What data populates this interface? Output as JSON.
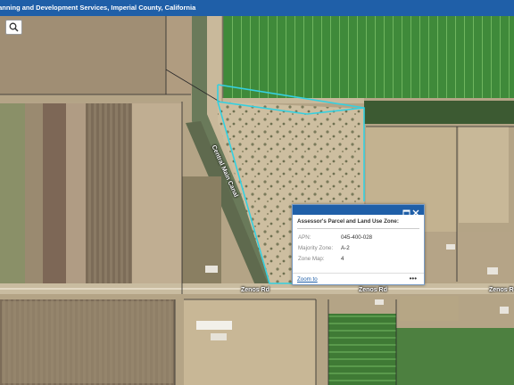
{
  "header": {
    "title": "lanning and Development Services, Imperial County, California"
  },
  "map": {
    "road_labels": [
      "Zenos Rd",
      "Zenos Rd",
      "Zenos R"
    ],
    "canal_label": "Central Main Canal",
    "parcel_outline_color": "#35d0e0"
  },
  "search": {
    "icon": "search-icon"
  },
  "popup": {
    "title": "Assessor's Parcel and Land Use Zone:",
    "rows": [
      {
        "label": "APN:",
        "value": "045-400-028"
      },
      {
        "label": "Majority Zone:",
        "value": "A-2"
      },
      {
        "label": "Zone Map:",
        "value": "4"
      }
    ],
    "zoom_label": "Zoom to",
    "more_label": "•••"
  },
  "colors": {
    "header_bg": "#1f5fa8",
    "accent": "#1f5fa8"
  }
}
